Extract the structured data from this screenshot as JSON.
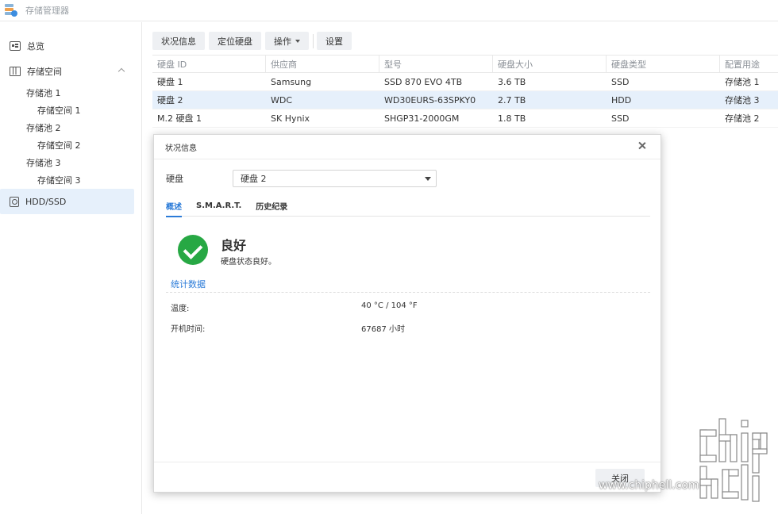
{
  "app": {
    "title": "存储管理器"
  },
  "sidebar": {
    "overview": "总览",
    "storage": "存储空间",
    "pools": [
      {
        "label": "存储池 1",
        "volume": "存储空间 1"
      },
      {
        "label": "存储池 2",
        "volume": "存储空间 2"
      },
      {
        "label": "存储池 3",
        "volume": "存储空间 3"
      }
    ],
    "hdd": "HDD/SSD"
  },
  "toolbar": {
    "status": "状况信息",
    "locate": "定位硬盘",
    "action": "操作",
    "settings": "设置"
  },
  "table": {
    "headers": [
      "硬盘 ID",
      "供应商",
      "型号",
      "硬盘大小",
      "硬盘类型",
      "配置用途"
    ],
    "rows": [
      [
        "硬盘 1",
        "Samsung",
        "SSD 870 EVO 4TB",
        "3.6 TB",
        "SSD",
        "存储池 1"
      ],
      [
        "硬盘 2",
        "WDC",
        "WD30EURS-63SPKY0",
        "2.7 TB",
        "HDD",
        "存储池 3"
      ],
      [
        "M.2 硬盘 1",
        "SK Hynix",
        "SHGP31-2000GM",
        "1.8 TB",
        "SSD",
        "存储池 2"
      ]
    ],
    "selected_row": 1
  },
  "dialog": {
    "title": "状况信息",
    "disk_label": "硬盘",
    "disk_value": "硬盘 2",
    "tabs": [
      "概述",
      "S.M.A.R.T.",
      "历史纪录"
    ],
    "status_title": "良好",
    "status_desc": "硬盘状态良好。",
    "section": "统计数据",
    "stats": [
      {
        "label": "温度:",
        "value": "40 °C / 104 °F"
      },
      {
        "label": "开机时间:",
        "value": "67687 小时"
      }
    ],
    "close": "关闭"
  },
  "watermark": {
    "text": "www.chiphell.com"
  },
  "colors": {
    "accent": "#2b7bd8",
    "selected": "#e6f0fb",
    "ok": "#27a844"
  }
}
